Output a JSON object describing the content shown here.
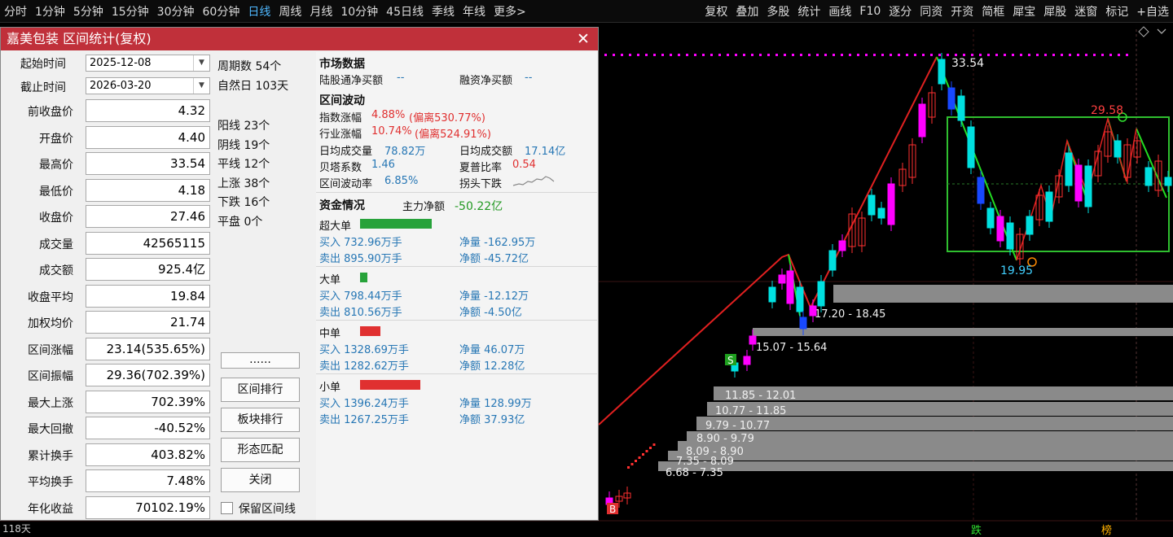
{
  "toolbar": {
    "periods": [
      "分时",
      "1分钟",
      "5分钟",
      "15分钟",
      "30分钟",
      "60分钟",
      "日线",
      "周线",
      "月线",
      "10分钟",
      "45日线",
      "季线",
      "年线",
      "更多>"
    ],
    "active_period": "日线",
    "tools": [
      "复权",
      "叠加",
      "多股",
      "统计",
      "画线",
      "F10",
      "逐分",
      "同资",
      "开资",
      "简框",
      "犀宝",
      "犀股",
      "迷窗",
      "标记",
      "+自选"
    ]
  },
  "dialog": {
    "title": "嘉美包装 区间统计(复权)",
    "close_icon": "close-icon",
    "start_label": "起始时间",
    "start_value": "2025-12-08",
    "end_label": "截止时间",
    "end_value": "2026-03-20",
    "stats": [
      {
        "label": "前收盘价",
        "value": "4.32"
      },
      {
        "label": "开盘价",
        "value": "4.40"
      },
      {
        "label": "最高价",
        "value": "33.54"
      },
      {
        "label": "最低价",
        "value": "4.18"
      },
      {
        "label": "收盘价",
        "value": "27.46"
      },
      {
        "label": "成交量",
        "value": "42565115"
      },
      {
        "label": "成交额",
        "value": "925.4亿"
      },
      {
        "label": "收盘平均",
        "value": "19.84"
      },
      {
        "label": "加权均价",
        "value": "21.74"
      },
      {
        "label": "区间涨幅",
        "value": "23.14(535.65%)"
      },
      {
        "label": "区间振幅",
        "value": "29.36(702.39%)"
      },
      {
        "label": "最大上涨",
        "value": "702.39%"
      },
      {
        "label": "最大回撤",
        "value": "-40.52%"
      },
      {
        "label": "累计换手",
        "value": "403.82%"
      },
      {
        "label": "平均换手",
        "value": "7.48%"
      },
      {
        "label": "年化收益",
        "value": "70102.19%"
      }
    ],
    "periods_count": "周期数 54个",
    "natural_days": "自然日 103天",
    "counts": [
      "阳线 23个",
      "阴线 19个",
      "平线 12个",
      "上涨 38个",
      "下跌 16个",
      "平盘 0个"
    ],
    "buttons": {
      "more": "......",
      "rank": "区间排行",
      "sector_rank": "板块排行",
      "pattern": "形态匹配",
      "close": "关闭"
    },
    "keep_line_label": "保留区间线",
    "market": {
      "title": "市场数据",
      "hk_label": "陆股通净买额",
      "hk_value": "--",
      "margin_label": "融资净买额",
      "margin_value": "--"
    },
    "volatility": {
      "title": "区间波动",
      "index_label": "指数涨幅",
      "index_value": "4.88%",
      "index_dev": "(偏离530.77%)",
      "industry_label": "行业涨幅",
      "industry_value": "10.74%",
      "industry_dev": "(偏离524.91%)",
      "avg_vol_label": "日均成交量",
      "avg_vol_value": "78.82万",
      "avg_amt_label": "日均成交额",
      "avg_amt_value": "17.14亿",
      "beta_label": "贝塔系数",
      "beta_value": "1.46",
      "sharpe_label": "夏普比率",
      "sharpe_value": "0.54",
      "volrate_label": "区间波动率",
      "volrate_value": "6.85%",
      "trend_label": "拐头下跌"
    },
    "capital": {
      "title": "资金情况",
      "main_label": "主力净额",
      "main_value": "-50.22亿",
      "groups": [
        {
          "name": "超大单",
          "color": "#27a23a",
          "bar": 0.85,
          "buy": "买入 732.96万手",
          "sell": "卖出 895.90万手",
          "net_vol": "净量 -162.95万",
          "net_amt": "净额 -45.72亿"
        },
        {
          "name": "大单",
          "color": "#27a23a",
          "bar": 0.09,
          "buy": "买入 798.44万手",
          "sell": "卖出 810.56万手",
          "net_vol": "净量 -12.12万",
          "net_amt": "净额 -4.50亿"
        },
        {
          "name": "中单",
          "color": "#e03030",
          "bar": 0.24,
          "buy": "买入 1328.69万手",
          "sell": "卖出 1282.62万手",
          "net_vol": "净量 46.07万",
          "net_amt": "净额 12.28亿"
        },
        {
          "name": "小单",
          "color": "#e03030",
          "bar": 0.71,
          "buy": "买入 1396.24万手",
          "sell": "卖出 1267.25万手",
          "net_vol": "净量 128.99万",
          "net_amt": "净额 37.93亿"
        }
      ]
    }
  },
  "chart": {
    "high_label": "33.54",
    "low_label": "19.95",
    "box_high_label": "29.58",
    "profile_ranges": [
      "17.20 - 18.45",
      "15.07 - 15.64",
      "11.85 - 12.01",
      "10.77 - 11.85",
      "9.79 - 10.77",
      "8.90 - 9.79",
      "8.09 - 8.90",
      "7.35 - 8.09",
      "6.68 - 7.35"
    ],
    "marker_s": "S",
    "marker_b": "B",
    "status_left": "118天",
    "status_die": "跌",
    "status_bang": "榜"
  }
}
